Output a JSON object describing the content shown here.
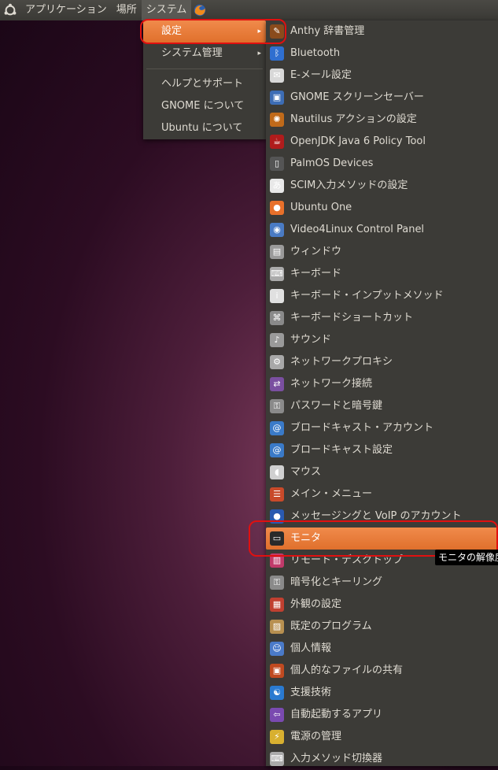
{
  "panel": {
    "applications": "アプリケーション",
    "places": "場所",
    "system": "システム"
  },
  "system_menu": {
    "items": [
      {
        "label": "設定",
        "arrow": "▸"
      },
      {
        "label": "システム管理",
        "arrow": "▸"
      },
      {
        "label": "ヘルプとサポート"
      },
      {
        "label": "GNOME について"
      },
      {
        "label": "Ubuntu について"
      }
    ]
  },
  "prefs_menu": {
    "items": [
      {
        "label": "Anthy 辞書管理",
        "icon": "dictionary-icon",
        "color": "#8a4b1c",
        "glyph": "✎"
      },
      {
        "label": "Bluetooth",
        "icon": "bluetooth-icon",
        "color": "#2f6fd0",
        "glyph": "ᛒ"
      },
      {
        "label": "E-メール設定",
        "icon": "email-icon",
        "color": "#d8d8d8",
        "glyph": "✉"
      },
      {
        "label": "GNOME スクリーンセーバー",
        "icon": "screensaver-icon",
        "color": "#3d6db5",
        "glyph": "▣"
      },
      {
        "label": "Nautilus アクションの設定",
        "icon": "nautilus-actions-icon",
        "color": "#c06a1a",
        "glyph": "✺"
      },
      {
        "label": "OpenJDK Java 6 Policy Tool",
        "icon": "java-policy-icon",
        "color": "#b01c1c",
        "glyph": "☕"
      },
      {
        "label": "PalmOS Devices",
        "icon": "palm-device-icon",
        "color": "#555555",
        "glyph": "▯"
      },
      {
        "label": "SCIM入力メソッドの設定",
        "icon": "scim-icon",
        "color": "#e8e8e8",
        "glyph": "あ"
      },
      {
        "label": "Ubuntu One",
        "icon": "ubuntu-one-icon",
        "color": "#e8702a",
        "glyph": "●"
      },
      {
        "label": "Video4Linux Control Panel",
        "icon": "video4linux-icon",
        "color": "#4a7bc4",
        "glyph": "◉"
      },
      {
        "label": "ウィンドウ",
        "icon": "window-icon",
        "color": "#9a9a9a",
        "glyph": "▤"
      },
      {
        "label": "キーボード",
        "icon": "keyboard-icon",
        "color": "#aaaaaa",
        "glyph": "⌨"
      },
      {
        "label": "キーボード・インプットメソッド",
        "icon": "input-method-icon",
        "color": "#e0e0e0",
        "glyph": "i"
      },
      {
        "label": "キーボードショートカット",
        "icon": "keyboard-shortcut-icon",
        "color": "#8a8a8a",
        "glyph": "⌘"
      },
      {
        "label": "サウンド",
        "icon": "sound-icon",
        "color": "#9a9a9a",
        "glyph": "♪"
      },
      {
        "label": "ネットワークプロキシ",
        "icon": "network-proxy-icon",
        "color": "#a8a8a8",
        "glyph": "⚙"
      },
      {
        "label": "ネットワーク接続",
        "icon": "network-connection-icon",
        "color": "#7a4fa0",
        "glyph": "⇄"
      },
      {
        "label": "パスワードと暗号鍵",
        "icon": "password-key-icon",
        "color": "#8a8a8a",
        "glyph": "⚿"
      },
      {
        "label": "ブロードキャスト・アカウント",
        "icon": "broadcast-account-icon",
        "color": "#3a7ac8",
        "glyph": "@"
      },
      {
        "label": "ブロードキャスト設定",
        "icon": "broadcast-settings-icon",
        "color": "#3a7ac8",
        "glyph": "@"
      },
      {
        "label": "マウス",
        "icon": "mouse-icon",
        "color": "#d0d0d0",
        "glyph": "◖"
      },
      {
        "label": "メイン・メニュー",
        "icon": "main-menu-icon",
        "color": "#c84a2a",
        "glyph": "☰"
      },
      {
        "label": "メッセージングと VoIP のアカウント",
        "icon": "messaging-voip-icon",
        "color": "#2a5ab0",
        "glyph": "●"
      },
      {
        "label": "モニタ",
        "icon": "monitor-icon",
        "color": "#2a2a2a",
        "glyph": "▭"
      },
      {
        "label": "リモート・デスクトップ",
        "icon": "remote-desktop-icon",
        "color": "#c03a6a",
        "glyph": "▥"
      },
      {
        "label": "暗号化とキーリング",
        "icon": "keyring-icon",
        "color": "#8a8a8a",
        "glyph": "⚿"
      },
      {
        "label": "外観の設定",
        "icon": "appearance-icon",
        "color": "#c04030",
        "glyph": "▦"
      },
      {
        "label": "既定のプログラム",
        "icon": "default-programs-icon",
        "color": "#b89050",
        "glyph": "▨"
      },
      {
        "label": "個人情報",
        "icon": "personal-info-icon",
        "color": "#4a7ac8",
        "glyph": "☺"
      },
      {
        "label": "個人的なファイルの共有",
        "icon": "file-sharing-icon",
        "color": "#c04a20",
        "glyph": "▣"
      },
      {
        "label": "支援技術",
        "icon": "accessibility-icon",
        "color": "#2a7ad0",
        "glyph": "☯"
      },
      {
        "label": "自動起動するアプリ",
        "icon": "startup-apps-icon",
        "color": "#7a4ab0",
        "glyph": "⇦"
      },
      {
        "label": "電源の管理",
        "icon": "power-management-icon",
        "color": "#d8b030",
        "glyph": "⚡"
      },
      {
        "label": "入力メソッド切換器",
        "icon": "input-switcher-icon",
        "color": "#aaaaaa",
        "glyph": "⌨"
      }
    ],
    "highlighted_index": 23
  },
  "tooltip": "モニタの解像度"
}
